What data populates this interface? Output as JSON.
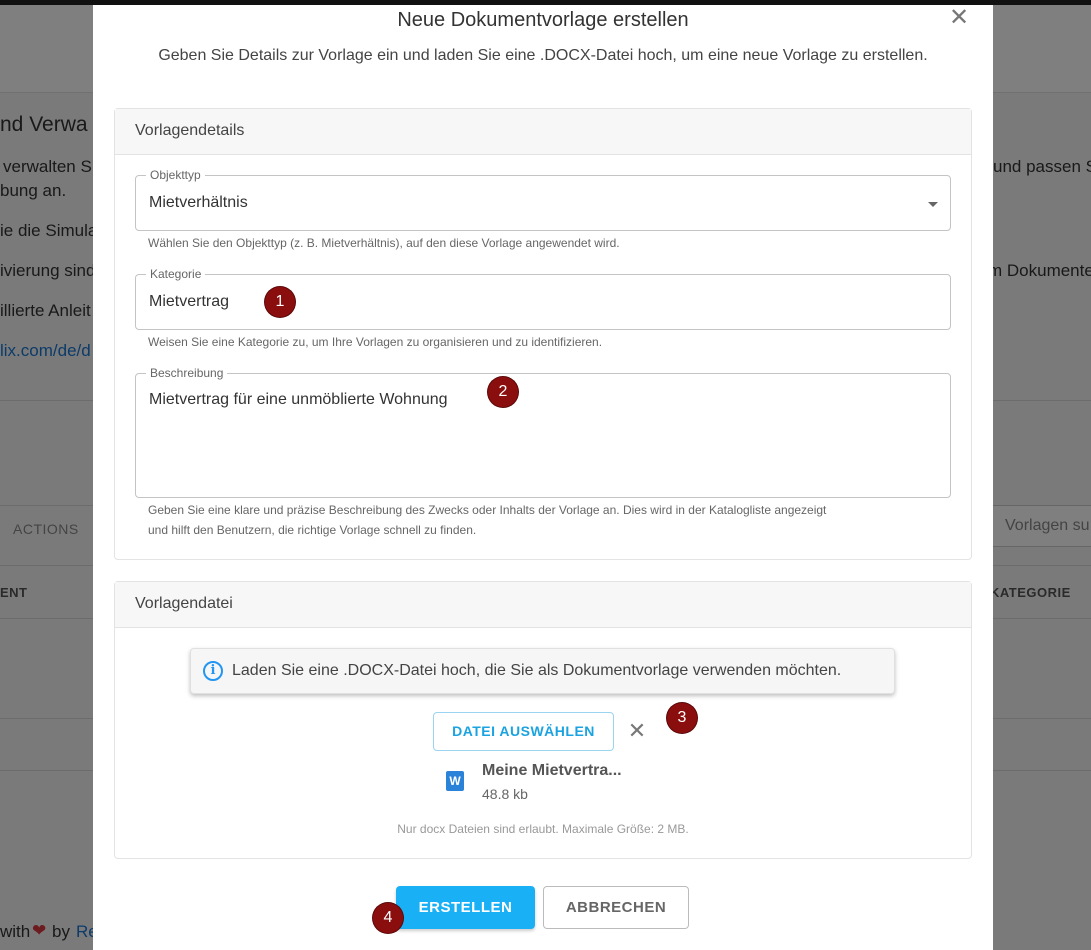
{
  "background": {
    "title_fragment": "nd Verwa",
    "lines_left": [
      "verwalten S",
      "bung an.",
      "ie die Simula",
      "ivierung sind",
      "illierte Anleit",
      "lix.com/de/d"
    ],
    "lines_right": [
      "und passen S",
      "m Dokumente"
    ],
    "tab_actions": "ACTIONS",
    "col_left": "ENT",
    "col_right": "KATEGORIE",
    "search_placeholder": "Vorlagen su",
    "footer_with": "with",
    "footer_heart": "❤",
    "footer_by": "by",
    "footer_link": "Re"
  },
  "modal": {
    "title": "Neue Dokumentvorlage erstellen",
    "close_icon": "close-icon",
    "subtitle": "Geben Sie Details zur Vorlage ein und laden Sie eine .DOCX-Datei hoch, um eine neue Vorlage zu erstellen."
  },
  "details": {
    "heading": "Vorlagendetails",
    "object_type": {
      "label": "Objekttyp",
      "value": "Mietverhältnis",
      "helper": "Wählen Sie den Objekttyp (z. B. Mietverhältnis), auf den diese Vorlage angewendet wird."
    },
    "category": {
      "label": "Kategorie",
      "value": "Mietvertrag",
      "helper": "Weisen Sie eine Kategorie zu, um Ihre Vorlagen zu organisieren und zu identifizieren."
    },
    "description": {
      "label": "Beschreibung",
      "value": "Mietvertrag für eine unmöblierte Wohnung",
      "helper_1": "Geben Sie eine klare und präzise Beschreibung des Zwecks oder Inhalts der Vorlage an. Dies wird in der Katalogliste angezeigt",
      "helper_2": "und hilft den Benutzern, die richtige Vorlage schnell zu finden."
    }
  },
  "file_section": {
    "heading": "Vorlagendatei",
    "info": "Laden Sie eine .DOCX-Datei hoch, die Sie als Dokumentvorlage verwenden möchten.",
    "choose_button": "DATEI AUSWÄHLEN",
    "clear_icon": "close-icon",
    "file_icon_letter": "W",
    "file_name": "Meine Mietvertra...",
    "file_size": "48.8 kb",
    "note": "Nur docx Dateien sind erlaubt. Maximale Größe: 2 MB."
  },
  "actions": {
    "create": "ERSTELLEN",
    "cancel": "ABBRECHEN"
  },
  "markers": [
    "1",
    "2",
    "3",
    "4"
  ],
  "colors": {
    "primary": "#1ab0f5",
    "marker": "#8b0e0e",
    "info": "#2196f3",
    "file_icon": "#2b82d9"
  }
}
